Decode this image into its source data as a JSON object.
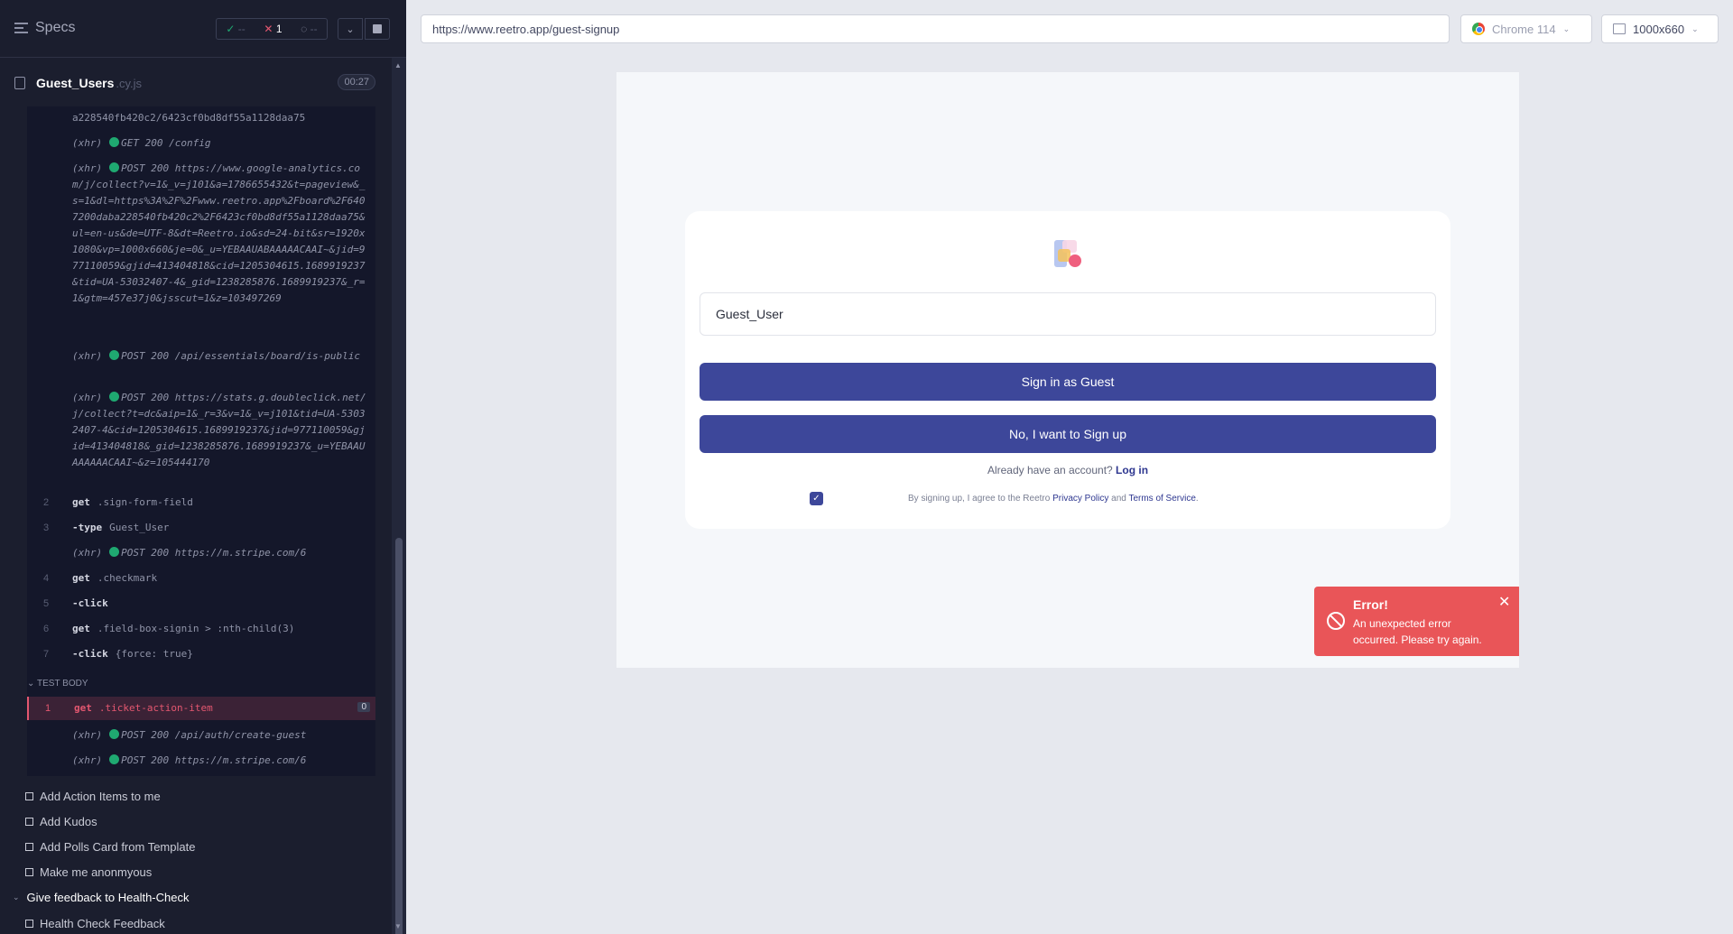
{
  "reporter": {
    "specs_label": "Specs",
    "stats": {
      "passed": "--",
      "failed": "1",
      "pending": "--"
    },
    "file": {
      "name": "Guest_Users",
      "ext": ".cy.js",
      "duration": "00:27"
    },
    "log": {
      "cont_url": "a228540fb420c2/6423cf0bd8df55a1128daa75",
      "xhr1": {
        "tag": "(xhr)",
        "text": "GET 200 /config"
      },
      "xhr2": {
        "tag": "(xhr)",
        "text": "POST 200 https://www.google-analytics.com/j/collect?v=1&_v=j101&a=1786655432&t=pageview&_s=1&dl=https%3A%2F%2Fwww.reetro.app%2Fboard%2F6407200daba228540fb420c2%2F6423cf0bd8df55a1128daa75&ul=en-us&de=UTF-8&dt=Reetro.io&sd=24-bit&sr=1920x1080&vp=1000x660&je=0&_u=YEBAAUABAAAAACAAI~&jid=977110059&gjid=413404818&cid=1205304615.1689919237&tid=UA-53032407-4&_gid=1238285876.1689919237&_r=1&gtm=457e37j0&jsscut=1&z=103497269"
      },
      "xhr3": {
        "tag": "(xhr)",
        "text": "POST 200 /api/essentials/board/is-public"
      },
      "xhr4": {
        "tag": "(xhr)",
        "text": "POST 200 https://stats.g.doubleclick.net/j/collect?t=dc&aip=1&_r=3&v=1&_v=j101&tid=UA-53032407-4&cid=1205304615.1689919237&jid=977110059&gjid=413404818&_gid=1238285876.1689919237&_u=YEBAAUAAAAAACAAI~&z=105444170"
      },
      "c2": {
        "ln": "2",
        "kw": "get",
        "arg": ".sign-form-field"
      },
      "c3": {
        "ln": "3",
        "kw": "-type",
        "arg": "Guest_User"
      },
      "xhr5": {
        "tag": "(xhr)",
        "text": "POST 200 https://m.stripe.com/6"
      },
      "c4": {
        "ln": "4",
        "kw": "get",
        "arg": ".checkmark"
      },
      "c5": {
        "ln": "5",
        "kw": "-click",
        "arg": ""
      },
      "c6": {
        "ln": "6",
        "kw": "get",
        "arg": ".field-box-signin > :nth-child(3)"
      },
      "c7": {
        "ln": "7",
        "kw": "-click",
        "arg": "{force: true}"
      },
      "test_body": "TEST BODY",
      "f1": {
        "ln": "1",
        "kw": "get",
        "arg": ".ticket-action-item",
        "badge": "0"
      },
      "xhr6": {
        "tag": "(xhr)",
        "text": "POST 200 /api/auth/create-guest"
      },
      "xhr7": {
        "tag": "(xhr)",
        "text": "POST 200 https://m.stripe.com/6"
      }
    },
    "tests": [
      "Add Action Items to me",
      "Add Kudos",
      "Add Polls Card from Template",
      "Make me anonmyous"
    ],
    "suite": "Give feedback to Health-Check",
    "suite_test": "Health Check Feedback"
  },
  "browser": {
    "url": "https://www.reetro.app/guest-signup",
    "browser_name": "Chrome 114",
    "viewport": "1000x660"
  },
  "app": {
    "name_value": "Guest_User",
    "guest_button": "Sign in as Guest",
    "signup_button": "No, I want to Sign up",
    "already_text": "Already have an account?",
    "login_link": "Log in",
    "agree_prefix": "By signing up, I agree to the Reetro",
    "privacy_link": "Privacy Policy",
    "and": "and",
    "terms_link": "Terms of Service",
    "terms_end": ".",
    "toast_title": "Error!",
    "toast_message": "An unexpected error occurred. Please try again.",
    "toast_close": "✕"
  },
  "colors": {
    "primary_button": "#3d479a",
    "error_toast": "#e95558",
    "pass_green": "#1fa971",
    "fail_red": "#e45770"
  }
}
